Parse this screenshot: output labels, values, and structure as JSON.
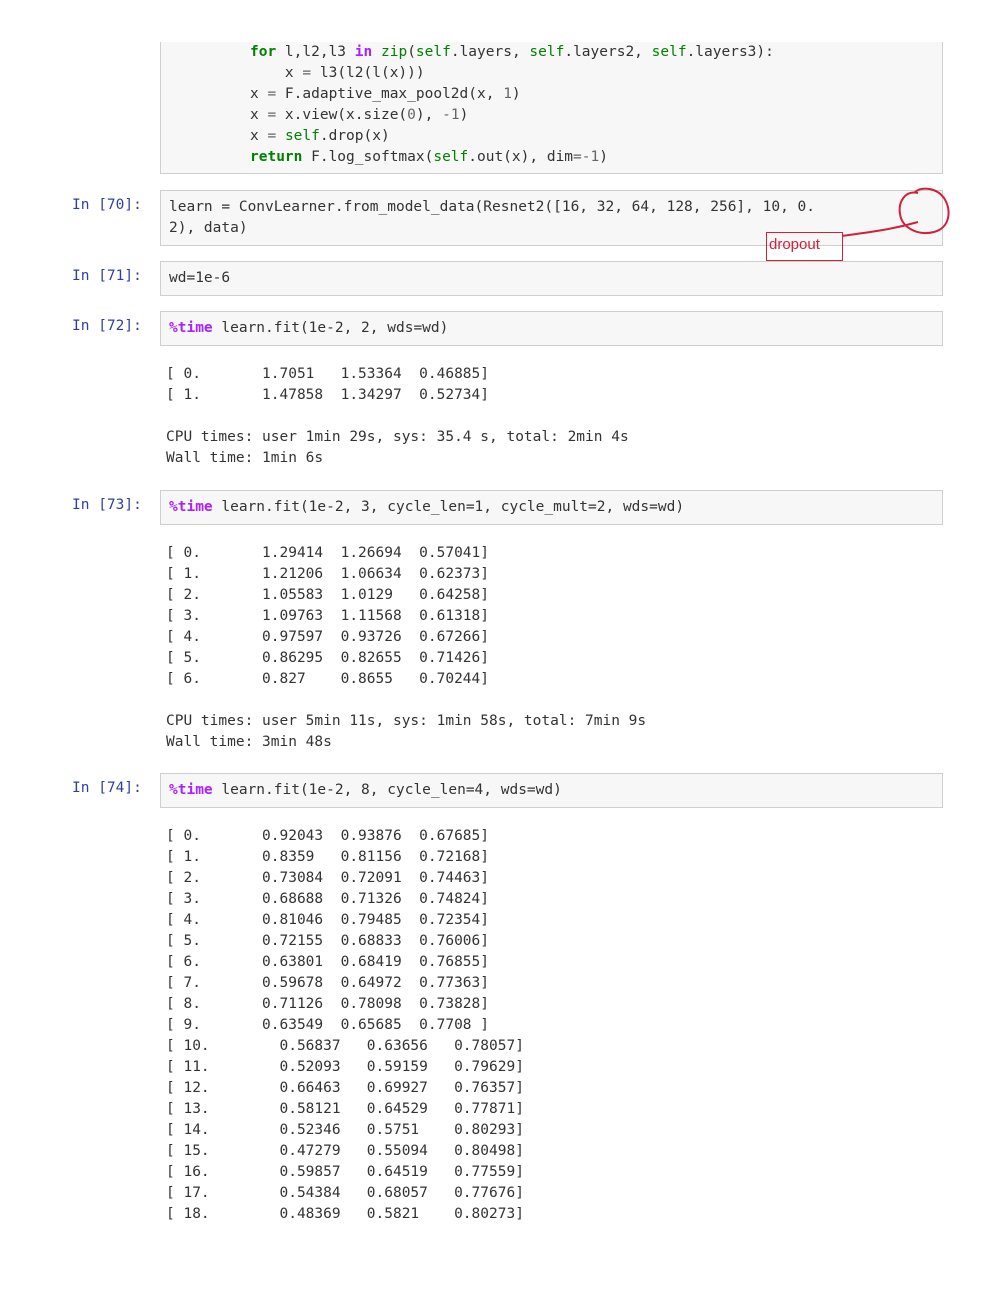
{
  "code_cell_1": {
    "lines": [
      "for l,l2,l3 in zip(self.layers, self.layers2, self.layers3):",
      "    x = l3(l2(l(x)))",
      "x = F.adaptive_max_pool2d(x, 1)",
      "x = x.view(x.size(0), -1)",
      "x = self.drop(x)",
      "return F.log_softmax(self.out(x), dim=-1)"
    ]
  },
  "cell_70": {
    "prompt": "In [70]:",
    "line1": "learn = ConvLearner.from_model_data(Resnet2([16, 32, 64, 128, 256], 10, 0.",
    "line2": "2), data)"
  },
  "annotation": {
    "label": "dropout",
    "color": "#d0203a"
  },
  "cell_71": {
    "prompt": "In [71]:",
    "code": "wd=1e-6"
  },
  "cell_72": {
    "prompt": "In [72]:",
    "magic": "%time",
    "code": " learn.fit(1e-2, 2, wds=wd)",
    "output": [
      "[ 0.       1.7051   1.53364  0.46885]",
      "[ 1.       1.47858  1.34297  0.52734]",
      "",
      "CPU times: user 1min 29s, sys: 35.4 s, total: 2min 4s",
      "Wall time: 1min 6s"
    ]
  },
  "cell_73": {
    "prompt": "In [73]:",
    "magic": "%time",
    "code": " learn.fit(1e-2, 3, cycle_len=1, cycle_mult=2, wds=wd)",
    "output": [
      "[ 0.       1.29414  1.26694  0.57041]",
      "[ 1.       1.21206  1.06634  0.62373]",
      "[ 2.       1.05583  1.0129   0.64258]",
      "[ 3.       1.09763  1.11568  0.61318]",
      "[ 4.       0.97597  0.93726  0.67266]",
      "[ 5.       0.86295  0.82655  0.71426]",
      "[ 6.       0.827    0.8655   0.70244]",
      "",
      "CPU times: user 5min 11s, sys: 1min 58s, total: 7min 9s",
      "Wall time: 3min 48s"
    ]
  },
  "cell_74": {
    "prompt": "In [74]:",
    "magic": "%time",
    "code": " learn.fit(1e-2, 8, cycle_len=4, wds=wd)",
    "output": [
      "[ 0.       0.92043  0.93876  0.67685]",
      "[ 1.       0.8359   0.81156  0.72168]",
      "[ 2.       0.73084  0.72091  0.74463]",
      "[ 3.       0.68688  0.71326  0.74824]",
      "[ 4.       0.81046  0.79485  0.72354]",
      "[ 5.       0.72155  0.68833  0.76006]",
      "[ 6.       0.63801  0.68419  0.76855]",
      "[ 7.       0.59678  0.64972  0.77363]",
      "[ 8.       0.71126  0.78098  0.73828]",
      "[ 9.       0.63549  0.65685  0.7708 ]",
      "[ 10.        0.56837   0.63656   0.78057]",
      "[ 11.        0.52093   0.59159   0.79629]",
      "[ 12.        0.66463   0.69927   0.76357]",
      "[ 13.        0.58121   0.64529   0.77871]",
      "[ 14.        0.52346   0.5751    0.80293]",
      "[ 15.        0.47279   0.55094   0.80498]",
      "[ 16.        0.59857   0.64519   0.77559]",
      "[ 17.        0.54384   0.68057   0.77676]",
      "[ 18.        0.48369   0.5821    0.80273]"
    ]
  }
}
